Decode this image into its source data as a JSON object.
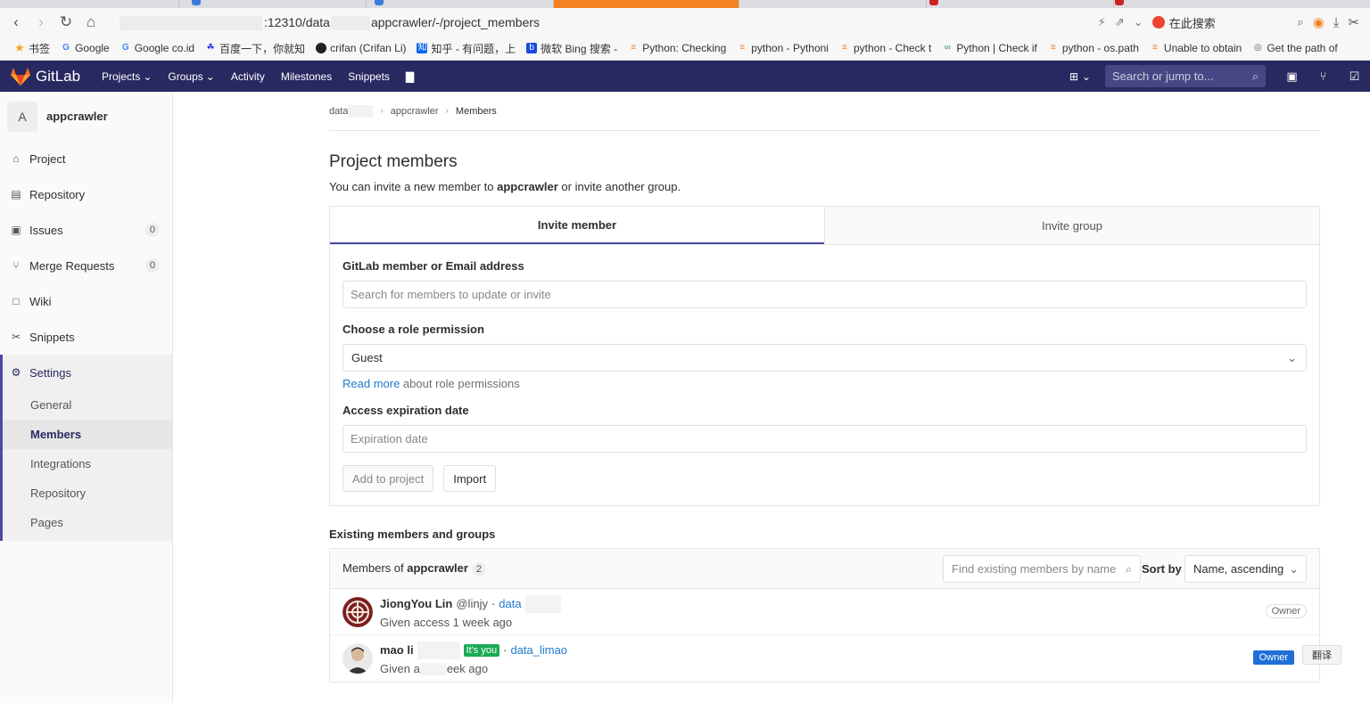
{
  "browser": {
    "url_prefix": ":12310/data",
    "url_suffix": "appcrawler/-/project_members",
    "search_label": "在此搜索",
    "bookmarks": [
      "书签",
      "Google",
      "Google co.id",
      "百度一下，你就知",
      "crifan (Crifan Li)",
      "知乎 - 有问题，上",
      "微软 Bing 搜索 -",
      "Python: Checking",
      "python - Pythoni",
      "python - Check t",
      "Python | Check if",
      "python - os.path",
      "Unable to obtain",
      "Get the path of"
    ]
  },
  "gitlab_header": {
    "brand": "GitLab",
    "nav": [
      "Projects",
      "Groups",
      "Activity",
      "Milestones",
      "Snippets"
    ],
    "search_placeholder": "Search or jump to..."
  },
  "sidebar": {
    "avatar_letter": "A",
    "project_name": "appcrawler",
    "items": [
      {
        "label": "Project"
      },
      {
        "label": "Repository"
      },
      {
        "label": "Issues",
        "count": "0"
      },
      {
        "label": "Merge Requests",
        "count": "0"
      },
      {
        "label": "Wiki"
      },
      {
        "label": "Snippets"
      }
    ],
    "settings_label": "Settings",
    "settings_sub": [
      "General",
      "Members",
      "Integrations",
      "Repository",
      "Pages"
    ]
  },
  "breadcrumb": {
    "group": "data",
    "project": "appcrawler",
    "current": "Members"
  },
  "page": {
    "title": "Project members",
    "desc_prefix": "You can invite a new member to ",
    "desc_project": "appcrawler",
    "desc_suffix": " or invite another group."
  },
  "invite": {
    "tab_member": "Invite member",
    "tab_group": "Invite group",
    "member_label": "GitLab member or Email address",
    "member_placeholder": "Search for members to update or invite",
    "role_label": "Choose a role permission",
    "role_value": "Guest",
    "read_more": "Read more",
    "read_more_suffix": " about role permissions",
    "expiration_label": "Access expiration date",
    "expiration_placeholder": "Expiration date",
    "add_button": "Add to project",
    "import_button": "Import"
  },
  "existing": {
    "title": "Existing members and groups",
    "members_of": "Members of ",
    "project": "appcrawler",
    "count": "2",
    "find_placeholder": "Find existing members by name",
    "sort_label": "Sort by",
    "sort_value": "Name, ascending",
    "members": [
      {
        "name": "JiongYou Lin",
        "username": "@linjy",
        "sep": "·",
        "group": "data",
        "access": "Given access 1 week ago",
        "role": "Owner"
      },
      {
        "name": "mao li",
        "itsyou": "It's you",
        "sep": "·",
        "group": "data_limao",
        "access_prefix": "Given a",
        "access_suffix": "eek ago",
        "role": "Owner"
      }
    ]
  },
  "translate_popup": "翻译"
}
